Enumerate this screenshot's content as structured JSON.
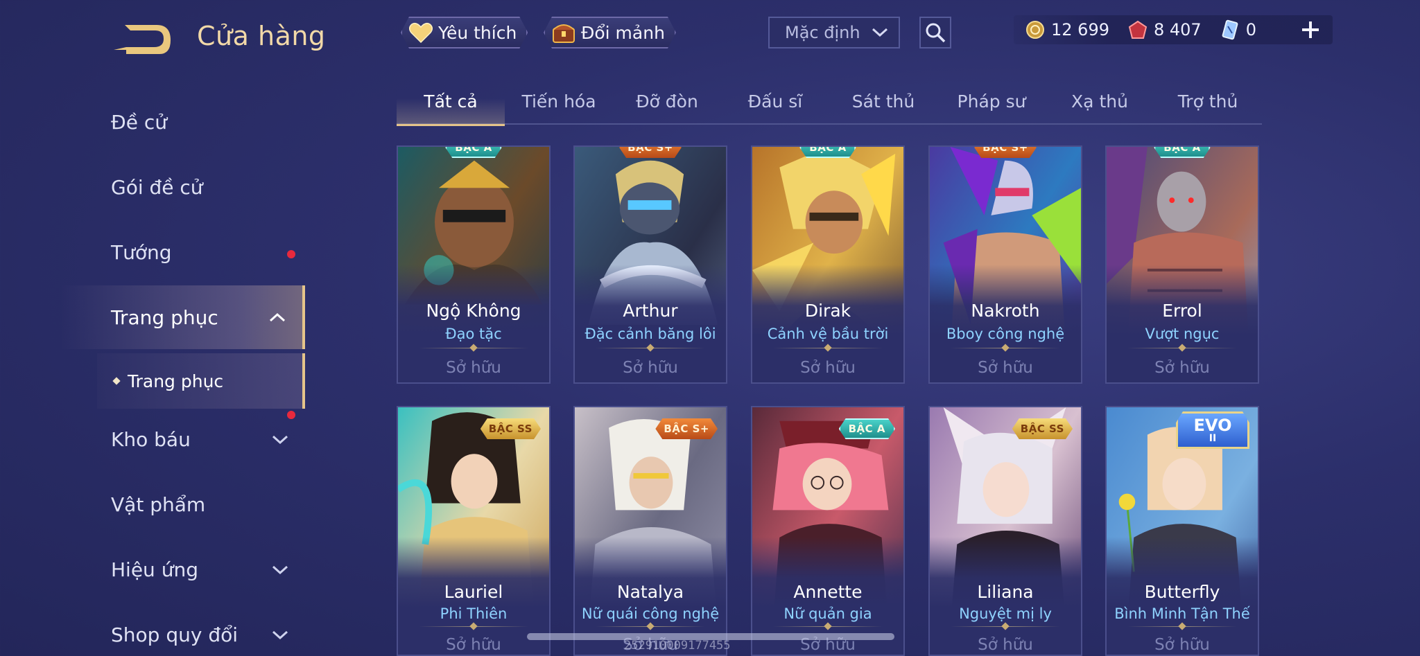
{
  "header": {
    "title": "Cửa hàng",
    "favorites_label": "Yêu thích",
    "exchange_label": "Đổi mảnh",
    "sort_value": "Mặc định"
  },
  "currency": {
    "gold": "12 699",
    "vouchers": "8 407",
    "tickets": "0"
  },
  "sidebar": {
    "items": [
      {
        "label": "Đề cử"
      },
      {
        "label": "Gói đề cử",
        "notification": true
      },
      {
        "label": "Tướng"
      },
      {
        "label": "Trang phục",
        "expanded": true,
        "active": true
      },
      {
        "label": "Kho báu",
        "notification": true
      },
      {
        "label": "Vật phẩm"
      },
      {
        "label": "Hiệu ứng"
      },
      {
        "label": "Shop quy đổi"
      }
    ],
    "sub_item": "Trang phục"
  },
  "tabs": [
    "Tất cả",
    "Tiến hóa",
    "Đỡ đòn",
    "Đấu sĩ",
    "Sát thủ",
    "Pháp sư",
    "Xạ thủ",
    "Trợ thủ"
  ],
  "active_tab": "Tất cả",
  "owned_label": "Sở hữu",
  "cards": [
    {
      "hero": "Ngộ Không",
      "skin": "Đạo tặc",
      "tier": "BẬC A"
    },
    {
      "hero": "Arthur",
      "skin": "Đặc cảnh băng lôi",
      "tier": "BẬC S+"
    },
    {
      "hero": "Dirak",
      "skin": "Cảnh vệ bầu trời",
      "tier": "BẬC A"
    },
    {
      "hero": "Nakroth",
      "skin": "Bboy công nghệ",
      "tier": "BẬC S+"
    },
    {
      "hero": "Errol",
      "skin": "Vượt ngục",
      "tier": "BẬC A"
    },
    {
      "hero": "Lauriel",
      "skin": "Phi Thiên",
      "tier": "BẬC SS"
    },
    {
      "hero": "Natalya",
      "skin": "Nữ quái công nghệ",
      "tier": "BẬC S+"
    },
    {
      "hero": "Annette",
      "skin": "Nữ quản gia",
      "tier": "BẬC A"
    },
    {
      "hero": "Liliana",
      "skin": "Nguyệt mị ly",
      "tier": "BẬC SS"
    },
    {
      "hero": "Butterfly",
      "skin": "Bình Minh Tận Thế",
      "tier": "EVO"
    }
  ],
  "evo_numeral": "II",
  "watermark": "252910009177455",
  "colors": {
    "accent_gold": "#e5c48a",
    "skin_name": "#8fd3ff",
    "notification": "#e8293d"
  }
}
